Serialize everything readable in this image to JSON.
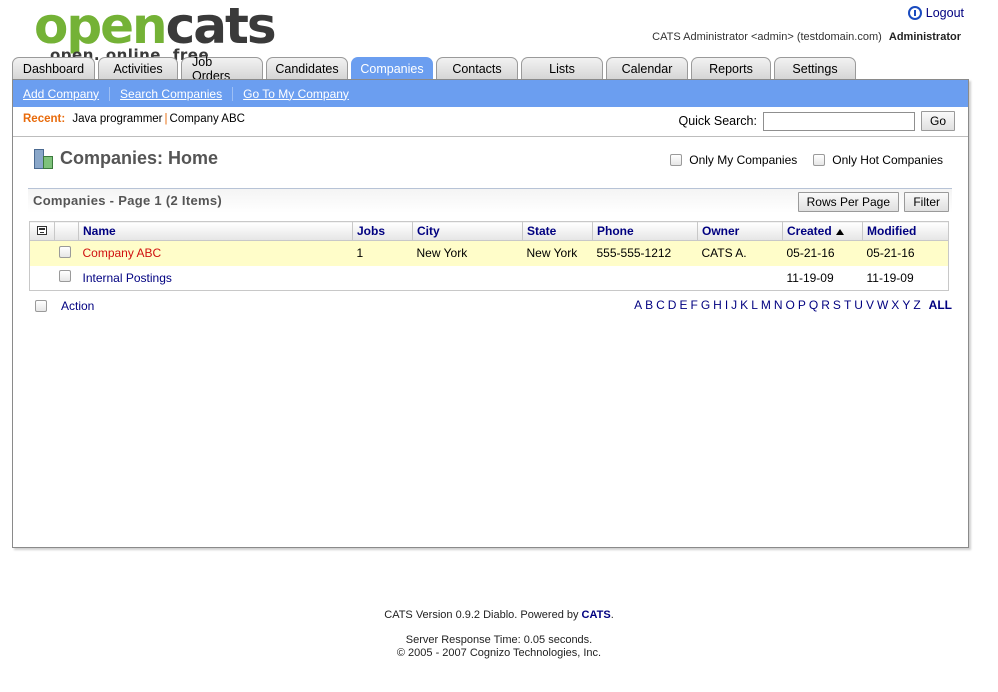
{
  "header": {
    "logo_open": "open",
    "logo_cats": "cats",
    "logo_tagline": "open. online. free.",
    "logout_label": "Logout",
    "user_info": "CATS Administrator <admin> (testdomain.com)",
    "user_role": "Administrator"
  },
  "tabs": [
    {
      "label": "Dashboard",
      "width": 83
    },
    {
      "label": "Activities",
      "width": 80
    },
    {
      "label": "Job Orders",
      "width": 82
    },
    {
      "label": "Candidates",
      "width": 82
    },
    {
      "label": "Companies",
      "width": 82,
      "active": true
    },
    {
      "label": "Contacts",
      "width": 82
    },
    {
      "label": "Lists",
      "width": 82
    },
    {
      "label": "Calendar",
      "width": 82
    },
    {
      "label": "Reports",
      "width": 80
    },
    {
      "label": "Settings",
      "width": 82
    }
  ],
  "subnav": [
    "Add Company",
    "Search Companies",
    "Go To My Company"
  ],
  "recent": {
    "label": "Recent:",
    "items": [
      "Java programmer",
      "Company ABC"
    ]
  },
  "quick_search": {
    "label": "Quick Search:",
    "value": "",
    "go_label": "Go"
  },
  "page": {
    "title": "Companies: Home",
    "filter_my": "Only My Companies",
    "filter_hot": "Only Hot Companies"
  },
  "list": {
    "title": "Companies - Page 1 (2 Items)",
    "rows_per_page_label": "Rows Per Page",
    "filter_label": "Filter",
    "columns": [
      "Name",
      "Jobs",
      "City",
      "State",
      "Phone",
      "Owner",
      "Created",
      "Modified"
    ],
    "sort_column": "Created",
    "rows": [
      {
        "name": "Company ABC",
        "jobs": "1",
        "city": "New York",
        "state": "New York",
        "phone": "555-555-1212",
        "owner": "CATS A.",
        "created": "05-21-16",
        "modified": "05-21-16",
        "hot": true
      },
      {
        "name": "Internal Postings",
        "jobs": "",
        "city": "",
        "state": "",
        "phone": "",
        "owner": "",
        "created": "11-19-09",
        "modified": "11-19-09",
        "hot": false
      }
    ],
    "action_label": "Action",
    "alphabet": [
      "A",
      "B",
      "C",
      "D",
      "E",
      "F",
      "G",
      "H",
      "I",
      "J",
      "K",
      "L",
      "M",
      "N",
      "O",
      "P",
      "Q",
      "R",
      "S",
      "T",
      "U",
      "V",
      "W",
      "X",
      "Y",
      "Z"
    ],
    "all_label": "ALL"
  },
  "footer": {
    "version_prefix": "CATS Version 0.9.2 Diablo. Powered by",
    "powered_by": "CATS",
    "version_suffix": ".",
    "response_time": "Server Response Time: 0.05 seconds.",
    "copyright": "© 2005 - 2007 Cognizo Technologies, Inc."
  }
}
